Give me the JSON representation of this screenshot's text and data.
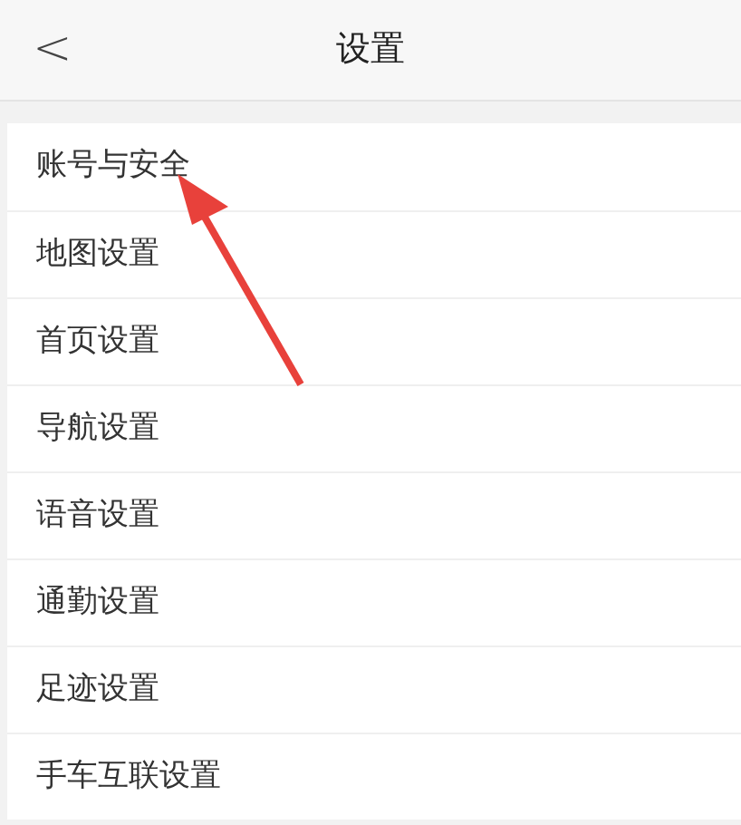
{
  "header": {
    "back": "<",
    "title": "设置"
  },
  "items": [
    {
      "label": "账号与安全"
    },
    {
      "label": "地图设置"
    },
    {
      "label": "首页设置"
    },
    {
      "label": "导航设置"
    },
    {
      "label": "语音设置"
    },
    {
      "label": "通勤设置"
    },
    {
      "label": "足迹设置"
    },
    {
      "label": "手车互联设置"
    }
  ]
}
